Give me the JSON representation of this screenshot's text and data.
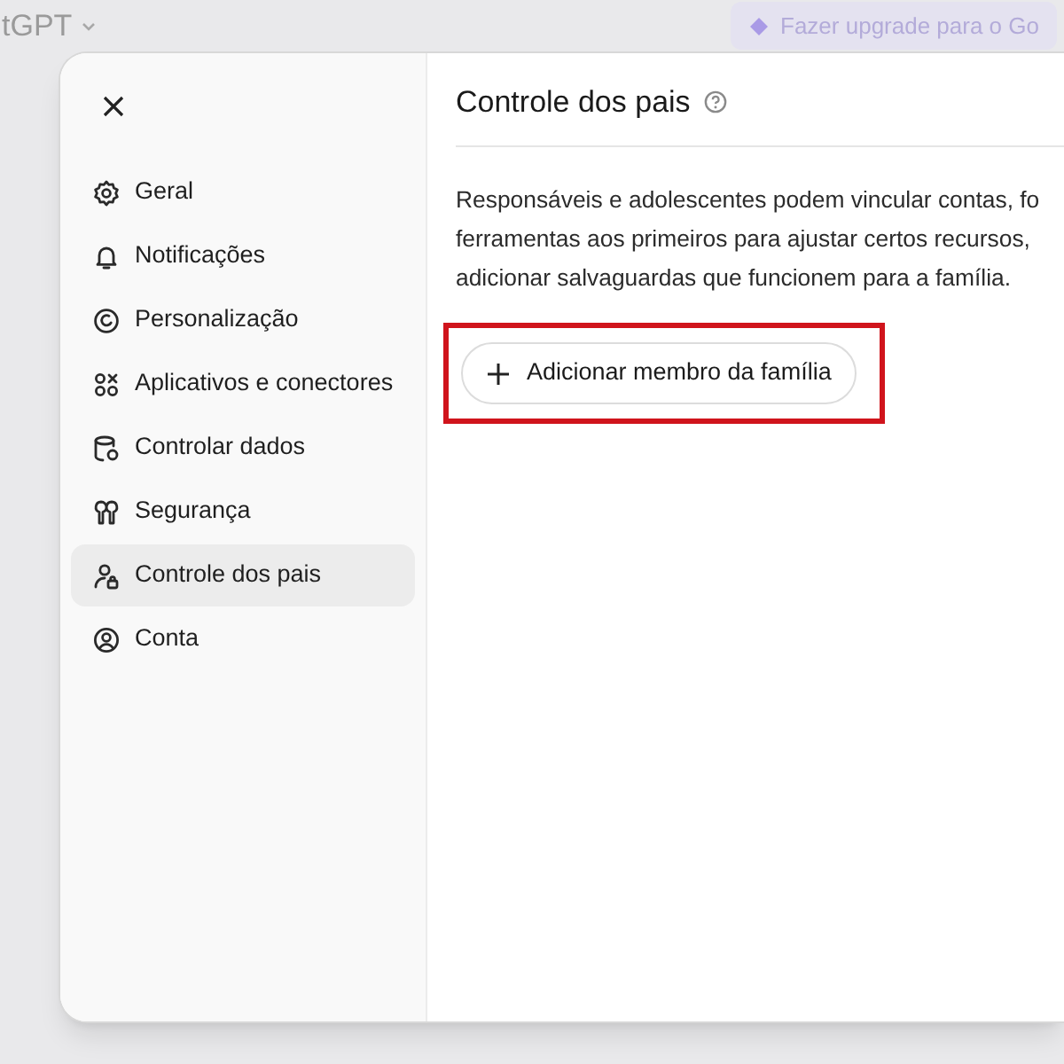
{
  "top_bar": {
    "app_name": "tGPT",
    "upgrade_button": "Fazer upgrade para o Go"
  },
  "sidebar": {
    "items": [
      {
        "label": "Geral",
        "selected": false
      },
      {
        "label": "Notificações",
        "selected": false
      },
      {
        "label": "Personalização",
        "selected": false
      },
      {
        "label": "Aplicativos e conectores",
        "selected": false
      },
      {
        "label": "Controlar dados",
        "selected": false
      },
      {
        "label": "Segurança",
        "selected": false
      },
      {
        "label": "Controle dos pais",
        "selected": true
      },
      {
        "label": "Conta",
        "selected": false
      }
    ]
  },
  "content": {
    "title": "Controle dos pais",
    "description": "Responsáveis e adolescentes podem vincular contas, fo\nferramentas aos primeiros para ajustar certos recursos,\nadicionar salvaguardas que funcionem para a família.",
    "add_button": "Adicionar membro da família",
    "highlighted": true
  }
}
